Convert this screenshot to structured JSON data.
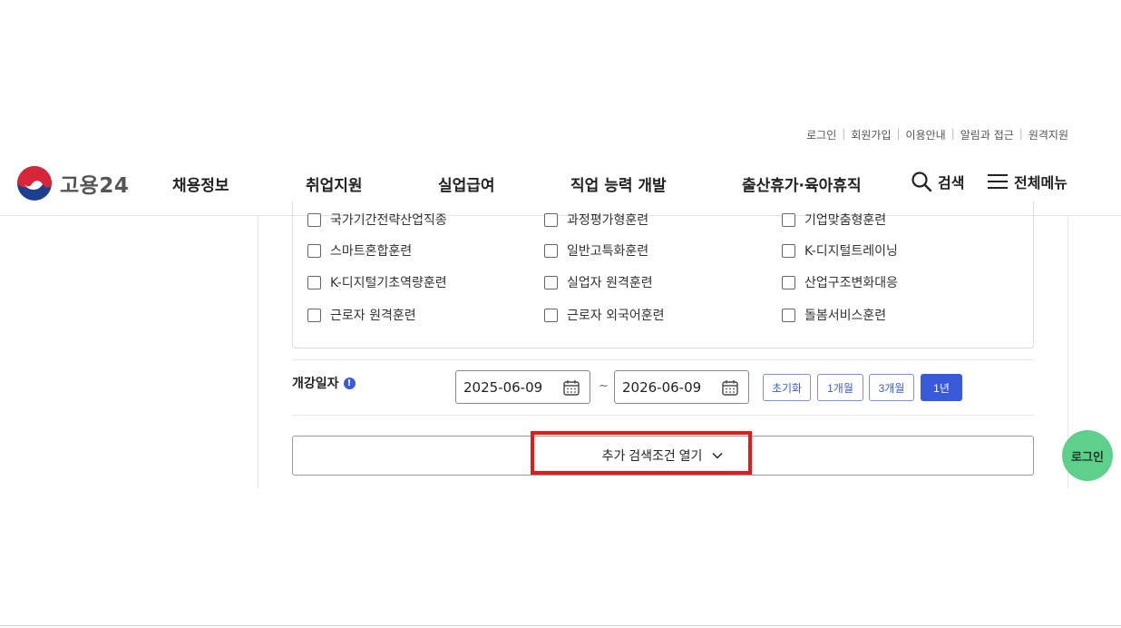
{
  "util_links": [
    "로그인",
    "회원가입",
    "이용안내",
    "알림과 접근",
    "원격지원"
  ],
  "logo": {
    "text": "고용24"
  },
  "nav": [
    "채용정보",
    "취업지원",
    "실업급여",
    "직업 능력 개발",
    "출산휴가·육아휴직"
  ],
  "header_utils": {
    "search": "검색",
    "menu": "전체메뉴"
  },
  "checkboxes": [
    {
      "label": "국가기간전략산업직종",
      "checked": false
    },
    {
      "label": "과정평가형훈련",
      "checked": false
    },
    {
      "label": "기업맞춤형훈련",
      "checked": false
    },
    {
      "label": "스마트혼합훈련",
      "checked": false
    },
    {
      "label": "일반고특화훈련",
      "checked": false
    },
    {
      "label": "K-디지털트레이닝",
      "checked": false
    },
    {
      "label": "K-디지털기초역량훈련",
      "checked": false
    },
    {
      "label": "실업자 원격훈련",
      "checked": false
    },
    {
      "label": "산업구조변화대응",
      "checked": false
    },
    {
      "label": "근로자 원격훈련",
      "checked": false
    },
    {
      "label": "근로자 외국어훈련",
      "checked": false
    },
    {
      "label": "돌봄서비스훈련",
      "checked": false
    }
  ],
  "date_filter": {
    "label": "개강일자",
    "info": "!",
    "start": "2025-06-09",
    "separator": "~",
    "end": "2026-06-09",
    "periods": [
      "초기화",
      "1개월",
      "3개월",
      "1년"
    ],
    "active_period": "1년"
  },
  "more_search": {
    "label": "추가 검색조건 열기"
  },
  "login_fab": "로그인",
  "colors": {
    "accent": "#3a5bd9",
    "highlight": "#e31b1b",
    "fab": "#5ed08b"
  }
}
